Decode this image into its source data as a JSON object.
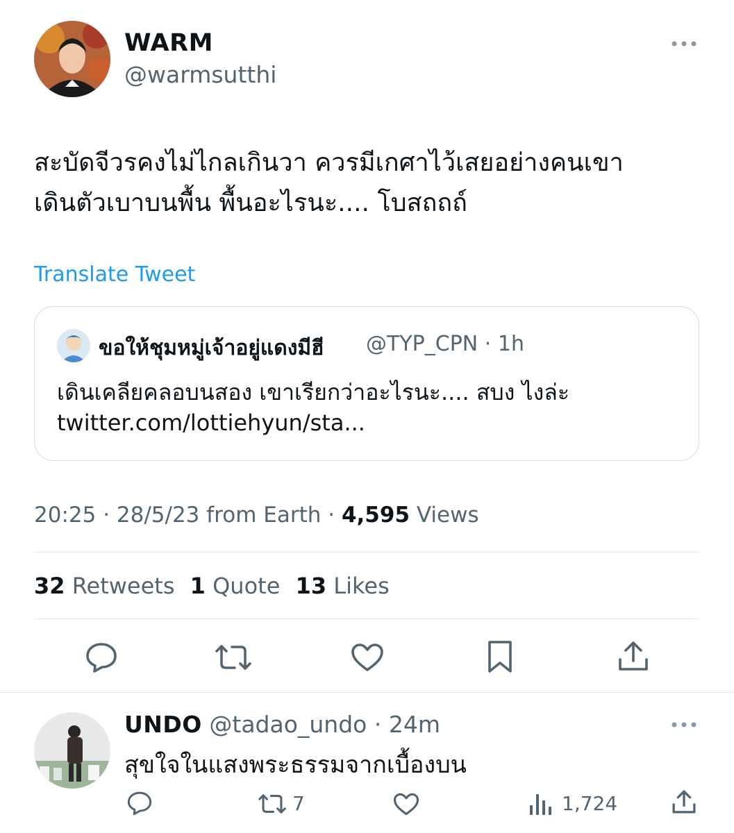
{
  "tweet": {
    "author": {
      "name": "WARM",
      "handle": "@warmsutthi"
    },
    "text_lines": [
      "สะบัดจีวรคงไม่ไกลเกินวา ควรมีเกศาไว้เสยอย่างคนเขา",
      "เดินตัวเบาบนพื้น พื้นอะไรนะ.... โบสถถถ์"
    ],
    "translate_label": "Translate Tweet",
    "quoted": {
      "author_name": "ขอให้ชุมหมู่เจ้าอยู่แดงมีฮี",
      "handle": "@TYP_CPN",
      "time": "· 1h",
      "text_line1": "เดินเคลียคลอบนสอง เขาเรียกว่าอะไรนะ.... สบง ไงล่ะ",
      "text_line2": "twitter.com/lottiehyun/sta..."
    },
    "meta": {
      "time_date": "20:25 · 28/5/23 from Earth ·",
      "views_count": "4,595",
      "views_label": "Views"
    },
    "stats": {
      "retweets_count": "32",
      "retweets_label": "Retweets",
      "quotes_count": "1",
      "quotes_label": "Quote",
      "likes_count": "13",
      "likes_label": "Likes"
    }
  },
  "reply": {
    "name": "UNDO",
    "handle": "@tadao_undo",
    "time": "· 24m",
    "text": "สุขใจในแสงพระธรรมจากเบื้องบน",
    "retweet_count": "7",
    "views_count": "1,724"
  },
  "icons": [
    "more-icon",
    "reply-icon",
    "retweet-icon",
    "like-icon",
    "bookmark-icon",
    "share-icon",
    "views-icon"
  ],
  "colors": {
    "link": "#1d9bf0",
    "text": "#0f1419",
    "muted": "#536471",
    "divider": "#e6e9ec"
  }
}
